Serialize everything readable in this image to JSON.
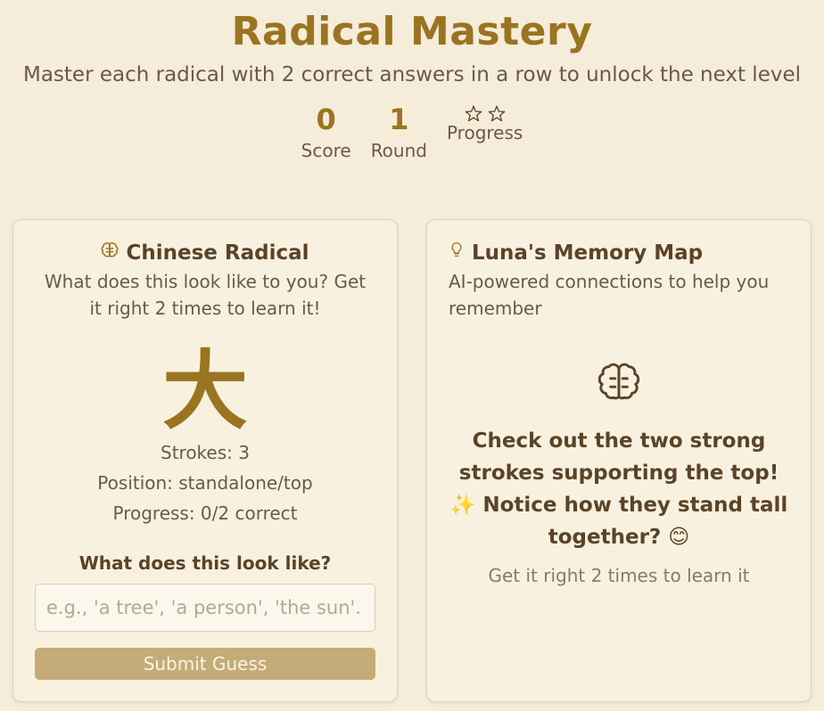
{
  "header": {
    "title": "Radical Mastery",
    "subtitle": "Master each radical with 2 correct answers in a row to unlock the next level"
  },
  "stats": {
    "score_value": "0",
    "score_label": "Score",
    "round_value": "1",
    "round_label": "Round",
    "progress_label": "Progress",
    "progress_stars_total": 2,
    "progress_stars_filled": 0
  },
  "radical_card": {
    "icon": "brain-icon",
    "title": "Chinese Radical",
    "description": "What does this look like to you? Get it right 2 times to learn it!",
    "character": "大",
    "strokes": "Strokes: 3",
    "position": "Position: standalone/top",
    "progress": "Progress: 0/2 correct",
    "question": "What does this look like?",
    "input_placeholder": "e.g., 'a tree', 'a person', 'the sun'.",
    "input_value": "",
    "submit_label": "Submit Guess"
  },
  "memory_card": {
    "icon": "lightbulb-icon",
    "title": "Luna's Memory Map",
    "description": "AI-powered connections to help you remember",
    "main_icon": "brain-icon",
    "message": "Check out the two strong strokes supporting the top! ✨ Notice how they stand tall together? 😊",
    "hint": "Get it right 2 times to learn it"
  },
  "colors": {
    "background": "#f5ecda",
    "accent": "#9a7420",
    "card": "#f8f1e0",
    "button": "#c4ab78"
  }
}
